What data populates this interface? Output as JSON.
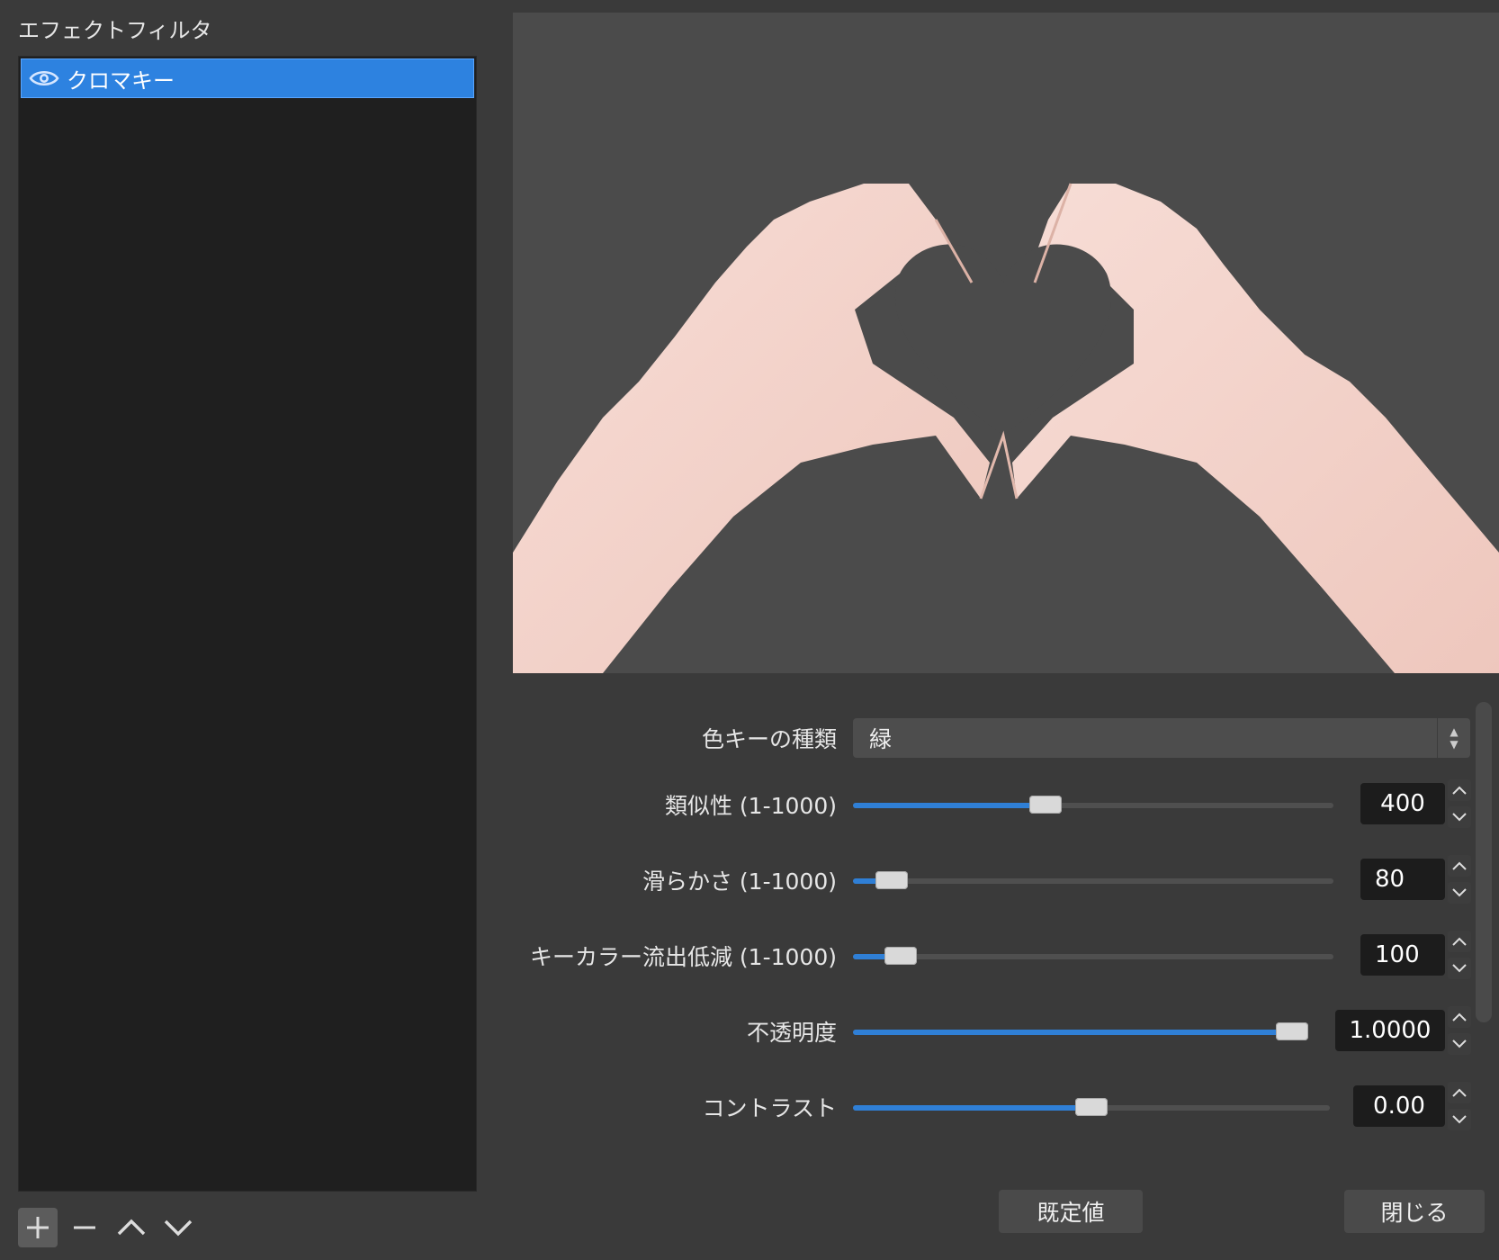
{
  "left_panel": {
    "title": "エフェクトフィルタ",
    "filters": [
      {
        "label": "クロマキー",
        "visible": true,
        "selected": true
      }
    ]
  },
  "properties": {
    "key_type": {
      "label": "色キーの種類",
      "value": "緑"
    },
    "similarity": {
      "label": "類似性 (1-1000)",
      "value": "400",
      "fraction": 0.4
    },
    "smoothness": {
      "label": "滑らかさ (1-1000)",
      "value": "80",
      "fraction": 0.08
    },
    "spill": {
      "label": "キーカラー流出低減 (1-1000)",
      "value": "100",
      "fraction": 0.1
    },
    "opacity": {
      "label": "不透明度",
      "value": "1.0000",
      "fraction": 1.0
    },
    "contrast": {
      "label": "コントラスト",
      "value": "0.00",
      "fraction": 0.5
    }
  },
  "buttons": {
    "defaults": "既定値",
    "close": "閉じる"
  },
  "colors": {
    "accent": "#2d82e0",
    "panel_bg": "#3a3a3a",
    "list_bg": "#1f1f1f"
  }
}
